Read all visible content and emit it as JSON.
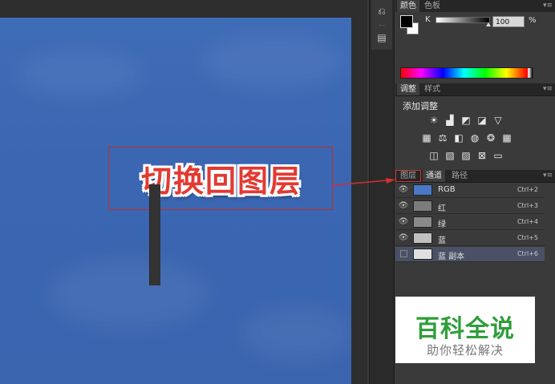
{
  "annotation": {
    "text": "切换回图层"
  },
  "color_panel": {
    "tabs": [
      "颜色",
      "色板"
    ],
    "channel_label": "K",
    "value": "100",
    "unit": "%"
  },
  "adjustments": {
    "tabs": [
      "调整",
      "样式"
    ],
    "title": "添加调整"
  },
  "channels_panel": {
    "tabs": [
      "图层",
      "通道",
      "路径"
    ],
    "rows": [
      {
        "name": "RGB",
        "shortcut": "Ctrl+2",
        "thumb_color": "#4a78c4",
        "visible": true
      },
      {
        "name": "红",
        "shortcut": "Ctrl+3",
        "thumb_color": "#7c7c7c",
        "visible": true
      },
      {
        "name": "绿",
        "shortcut": "Ctrl+4",
        "thumb_color": "#8a8a8a",
        "visible": true
      },
      {
        "name": "蓝",
        "shortcut": "Ctrl+5",
        "thumb_color": "#c0c0c0",
        "visible": true
      },
      {
        "name": "蓝 副本",
        "shortcut": "Ctrl+6",
        "thumb_color": "#e0e0e0",
        "visible": false
      }
    ]
  },
  "watermark": {
    "title": "百科全说",
    "subtitle": "助你轻松解决"
  },
  "colors": {
    "canvas_blue": "#3b66b2",
    "annotation_red": "#e23a32",
    "watermark_green": "#2f9e3a"
  }
}
